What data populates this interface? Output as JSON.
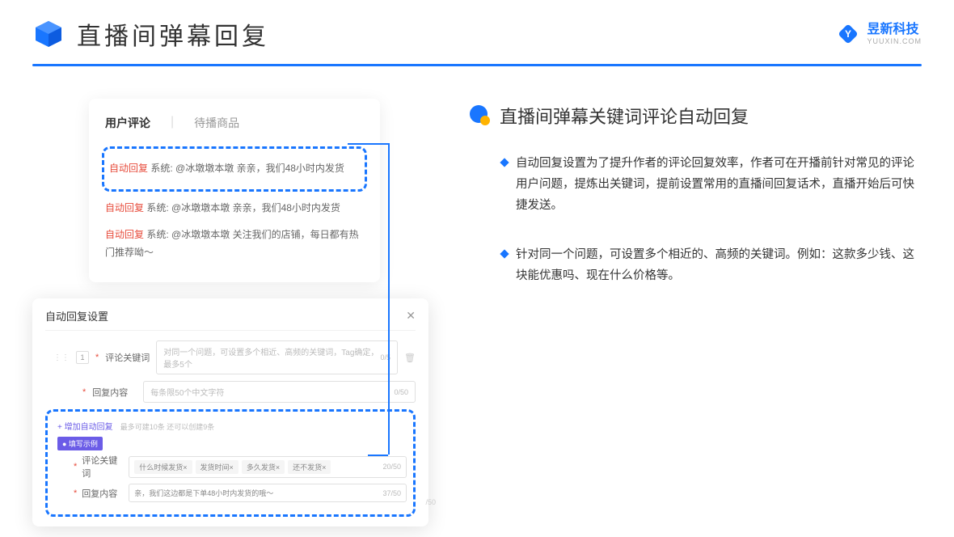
{
  "header": {
    "title": "直播间弹幕回复",
    "logo_cn": "昱新科技",
    "logo_en": "YUUXIN.COM"
  },
  "comments_card": {
    "tab_active": "用户评论",
    "tab_inactive": "待播商品",
    "row1_tag": "自动回复",
    "row1_sys": "系统:",
    "row1_text": "@冰墩墩本墩 亲亲，我们48小时内发货",
    "row2_tag": "自动回复",
    "row2_sys": "系统:",
    "row2_text": "@冰墩墩本墩 亲亲，我们48小时内发货",
    "row3_tag": "自动回复",
    "row3_sys": "系统:",
    "row3_text": "@冰墩墩本墩 关注我们的店铺，每日都有热门推荐呦～"
  },
  "settings": {
    "title": "自动回复设置",
    "num": "1",
    "keyword_label": "评论关键词",
    "keyword_placeholder": "对同一个问题，可设置多个相近、高频的关键词，Tag确定，最多5个",
    "keyword_counter": "0/5",
    "content_label": "回复内容",
    "content_placeholder": "每条限50个中文字符",
    "content_counter": "0/50",
    "add_link": "+ 增加自动回复",
    "add_hint": "最多可建10条 还可以创建9条",
    "example_badge": "● 填写示例",
    "ex_keyword_label": "评论关键词",
    "ex_tag1": "什么时候发货×",
    "ex_tag2": "发货时间×",
    "ex_tag3": "多久发货×",
    "ex_tag4": "还不发货×",
    "ex_keyword_counter": "20/50",
    "ex_content_label": "回复内容",
    "ex_content_text": "亲，我们这边都是下单48小时内发货的哦～",
    "ex_content_counter": "37/50",
    "extra_counter": "/50"
  },
  "right": {
    "section_title": "直播间弹幕关键词评论自动回复",
    "bullet1": "自动回复设置为了提升作者的评论回复效率，作者可在开播前针对常见的评论用户问题，提炼出关键词，提前设置常用的直播间回复话术，直播开始后可快捷发送。",
    "bullet2": "针对同一个问题，可设置多个相近的、高频的关键词。例如：这款多少钱、这块能优惠吗、现在什么价格等。"
  }
}
